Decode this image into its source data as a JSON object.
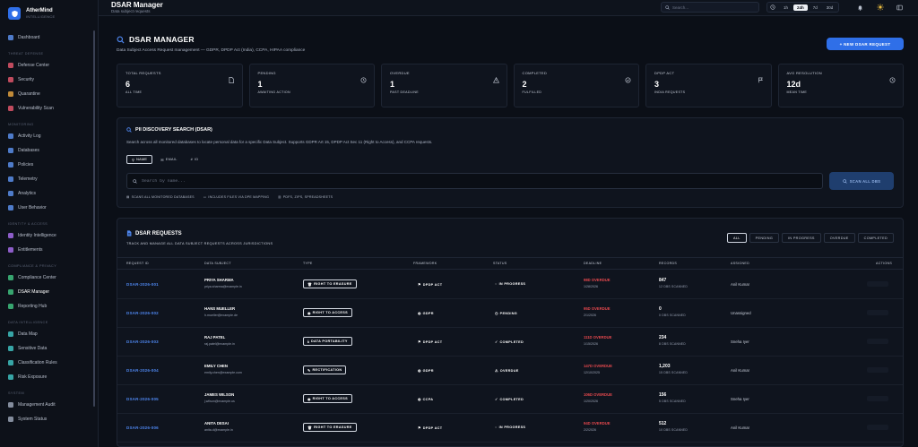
{
  "brand": {
    "name": "AtherMind",
    "tagline": "INTELLIGENCE"
  },
  "sidebar": {
    "items": [
      {
        "type": "item",
        "label": "Dashboard",
        "icon": "grid-icon",
        "color": "#5b8ee9"
      },
      {
        "type": "section",
        "label": "THREAT DEFENSE"
      },
      {
        "type": "item",
        "label": "Defense Center",
        "icon": "shield-icon",
        "color": "#e0566b"
      },
      {
        "type": "item",
        "label": "Security",
        "icon": "lock-icon",
        "color": "#e0566b"
      },
      {
        "type": "item",
        "label": "Quarantine",
        "icon": "ban-icon",
        "color": "#e0a040"
      },
      {
        "type": "item",
        "label": "Vulnerability Scan",
        "icon": "bug-icon",
        "color": "#e0566b"
      },
      {
        "type": "section",
        "label": "MONITORING"
      },
      {
        "type": "item",
        "label": "Activity Log",
        "icon": "list-icon",
        "color": "#5b8ee9"
      },
      {
        "type": "item",
        "label": "Databases",
        "icon": "database-icon",
        "color": "#5b8ee9"
      },
      {
        "type": "item",
        "label": "Policies",
        "icon": "shield-check-icon",
        "color": "#5b8ee9"
      },
      {
        "type": "item",
        "label": "Telemetry",
        "icon": "pulse-icon",
        "color": "#5b8ee9"
      },
      {
        "type": "item",
        "label": "Analytics",
        "icon": "chart-icon",
        "color": "#5b8ee9"
      },
      {
        "type": "item",
        "label": "User Behavior",
        "icon": "users-icon",
        "color": "#5b8ee9"
      },
      {
        "type": "section",
        "label": "IDENTITY & ACCESS"
      },
      {
        "type": "item",
        "label": "Identity Intelligence",
        "icon": "fingerprint-icon",
        "color": "#a46be8"
      },
      {
        "type": "item",
        "label": "Entitlements",
        "icon": "key-icon",
        "color": "#a46be8"
      },
      {
        "type": "section",
        "label": "COMPLIANCE & PRIVACY"
      },
      {
        "type": "item",
        "label": "Compliance Center",
        "icon": "clipboard-icon",
        "color": "#3fbf7f"
      },
      {
        "type": "item",
        "label": "DSAR Manager",
        "icon": "search-icon",
        "color": "#3fbf7f",
        "active": true
      },
      {
        "type": "item",
        "label": "Reporting Hub",
        "icon": "trend-icon",
        "color": "#3fbf7f"
      },
      {
        "type": "section",
        "label": "DATA INTELLIGENCE"
      },
      {
        "type": "item",
        "label": "Data Map",
        "icon": "map-icon",
        "color": "#3fbfbf"
      },
      {
        "type": "item",
        "label": "Sensitive Data",
        "icon": "file-icon",
        "color": "#3fbfbf"
      },
      {
        "type": "item",
        "label": "Classification Rules",
        "icon": "filter-icon",
        "color": "#3fbfbf"
      },
      {
        "type": "item",
        "label": "Risk Exposure",
        "icon": "alert-icon",
        "color": "#3fbfbf"
      },
      {
        "type": "section",
        "label": "SYSTEM"
      },
      {
        "type": "item",
        "label": "Management Audit",
        "icon": "doc-icon",
        "color": "#9aa3b5"
      },
      {
        "type": "item",
        "label": "System Status",
        "icon": "server-icon",
        "color": "#9aa3b5"
      }
    ]
  },
  "topbar": {
    "title": "DSAR Manager",
    "subtitle": "Data subject requests",
    "search_placeholder": "Search...",
    "ranges": [
      "1h",
      "24h",
      "7d",
      "30d"
    ],
    "active_range": "24h"
  },
  "page": {
    "title": "DSAR MANAGER",
    "description": "Data Subject Access Request management — GDPR, DPDP Act (India), CCPA, HIPAA compliance",
    "new_button": "+ NEW DSAR REQUEST"
  },
  "stats": [
    {
      "label": "TOTAL REQUESTS",
      "value": "6",
      "sub": "ALL TIME",
      "icon": "document-icon"
    },
    {
      "label": "PENDING",
      "value": "1",
      "sub": "AWAITING ACTION",
      "icon": "clock-icon"
    },
    {
      "label": "OVERDUE",
      "value": "1",
      "sub": "PAST DEADLINE",
      "icon": "warning-icon"
    },
    {
      "label": "COMPLETED",
      "value": "2",
      "sub": "FULFILLED",
      "icon": "check-circle-icon"
    },
    {
      "label": "DPDP ACT",
      "value": "3",
      "sub": "INDIA REQUESTS",
      "icon": "flag-icon"
    },
    {
      "label": "AVG RESOLUTION",
      "value": "12d",
      "sub": "MEAN TIME",
      "icon": "clock-icon"
    }
  ],
  "pii": {
    "title": "PII DISCOVERY SEARCH (DSAR)",
    "description": "Search across all monitored databases to locate personal data for a specific Data Subject. Supports GDPR Art 15, DPDP Act Sec 11 (Right to Access), and CCPA requests.",
    "tabs": [
      "NAME",
      "EMAIL",
      "ID"
    ],
    "active_tab": "NAME",
    "search_placeholder": "Search by name...",
    "scan_button": "SCAN ALL DBS",
    "notes": [
      "SCANS ALL MONITORED DATABASES",
      "INCLUDES FILES VIA DPE MAPPING",
      "PDFS, ZIPS, SPREADSHEETS"
    ]
  },
  "requests": {
    "title": "DSAR REQUESTS",
    "subtitle": "TRACK AND MANAGE ALL DATA SUBJECT REQUESTS ACROSS JURISDICTIONS",
    "filters": [
      "ALL",
      "PENDING",
      "IN PROGRESS",
      "OVERDUE",
      "COMPLETED"
    ],
    "active_filter": "ALL",
    "columns": [
      "REQUEST ID",
      "DATA SUBJECT",
      "TYPE",
      "FRAMEWORK",
      "STATUS",
      "DEADLINE",
      "RECORDS",
      "ASSIGNED",
      "ACTIONS"
    ],
    "rows": [
      {
        "id": "DSAR-2026-001",
        "name": "PRIYA SHARMA",
        "email": "priya.sharma@example.in",
        "type": "RIGHT TO ERASURE",
        "type_icon": "trash-icon",
        "framework": "DPDP ACT",
        "fw_icon": "flag-icon",
        "status": "IN PROGRESS",
        "status_icon": "spinner-icon",
        "overdue": "98D OVERDUE",
        "date": "1/28/2026",
        "records": "847",
        "records_sub": "12 DBS SCANNED",
        "assignee": "Anil Kumar"
      },
      {
        "id": "DSAR-2026-002",
        "name": "HANS MUELLER",
        "email": "h.mueller@example.de",
        "type": "RIGHT TO ACCESS",
        "type_icon": "eye-icon",
        "framework": "GDPR",
        "fw_icon": "globe-icon",
        "status": "PENDING",
        "status_icon": "clock-icon",
        "overdue": "95D OVERDUE",
        "date": "2/1/2026",
        "records": "0",
        "records_sub": "0 DBS SCANNED",
        "assignee": "Unassigned"
      },
      {
        "id": "DSAR-2026-003",
        "name": "RAJ PATEL",
        "email": "raj.patel@example.in",
        "type": "DATA PORTABILITY",
        "type_icon": "download-icon",
        "framework": "DPDP ACT",
        "fw_icon": "flag-icon",
        "status": "COMPLETED",
        "status_icon": "check-icon",
        "overdue": "111D OVERDUE",
        "date": "1/15/2026",
        "records": "234",
        "records_sub": "8 DBS SCANNED",
        "assignee": "Sneha Iyer"
      },
      {
        "id": "DSAR-2026-004",
        "name": "EMILY CHEN",
        "email": "emily.chen@example.com",
        "type": "RECTIFICATION",
        "type_icon": "edit-icon",
        "framework": "GDPR",
        "fw_icon": "globe-icon",
        "status": "OVERDUE",
        "status_icon": "warning-icon",
        "overdue": "147D OVERDUE",
        "date": "12/10/2025",
        "records": "1,203",
        "records_sub": "15 DBS SCANNED",
        "assignee": "Anil Kumar"
      },
      {
        "id": "DSAR-2026-005",
        "name": "JAMES WILSON",
        "email": "j.wilson@example.us",
        "type": "RIGHT TO ACCESS",
        "type_icon": "eye-icon",
        "framework": "CCPA",
        "fw_icon": "globe-icon",
        "status": "COMPLETED",
        "status_icon": "check-icon",
        "overdue": "106D OVERDUE",
        "date": "1/20/2026",
        "records": "156",
        "records_sub": "5 DBS SCANNED",
        "assignee": "Sneha Iyer"
      },
      {
        "id": "DSAR-2026-006",
        "name": "ANITA DESAI",
        "email": "anita.d@example.in",
        "type": "RIGHT TO ERASURE",
        "type_icon": "trash-icon",
        "framework": "DPDP ACT",
        "fw_icon": "flag-icon",
        "status": "IN PROGRESS",
        "status_icon": "spinner-icon",
        "overdue": "94D OVERDUE",
        "date": "2/2/2026",
        "records": "512",
        "records_sub": "10 DBS SCANNED",
        "assignee": "Anil Kumar"
      }
    ]
  }
}
